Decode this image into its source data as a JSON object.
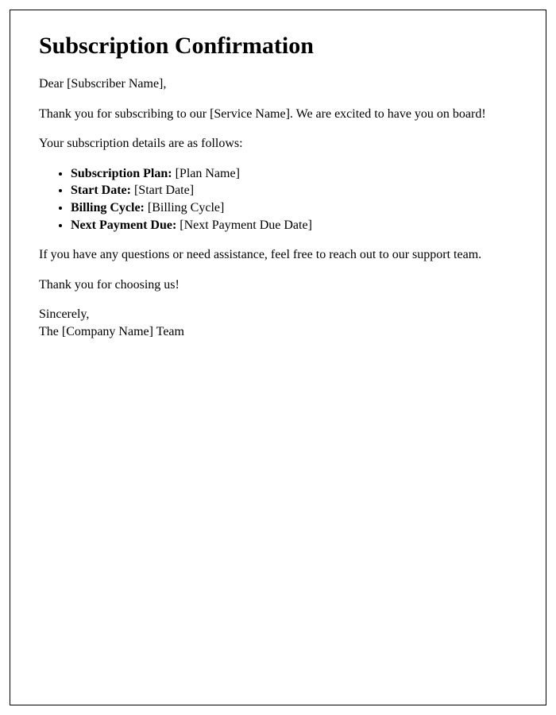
{
  "title": "Subscription Confirmation",
  "greeting": "Dear [Subscriber Name],",
  "intro": "Thank you for subscribing to our [Service Name]. We are excited to have you on board!",
  "details_lead": "Your subscription details are as follows:",
  "details": [
    {
      "label": "Subscription Plan:",
      "value": " [Plan Name]"
    },
    {
      "label": "Start Date:",
      "value": " [Start Date]"
    },
    {
      "label": "Billing Cycle:",
      "value": " [Billing Cycle]"
    },
    {
      "label": "Next Payment Due:",
      "value": " [Next Payment Due Date]"
    }
  ],
  "support_note": "If you have any questions or need assistance, feel free to reach out to our support team.",
  "thanks": "Thank you for choosing us!",
  "closing": "Sincerely,",
  "signature": "The [Company Name] Team"
}
